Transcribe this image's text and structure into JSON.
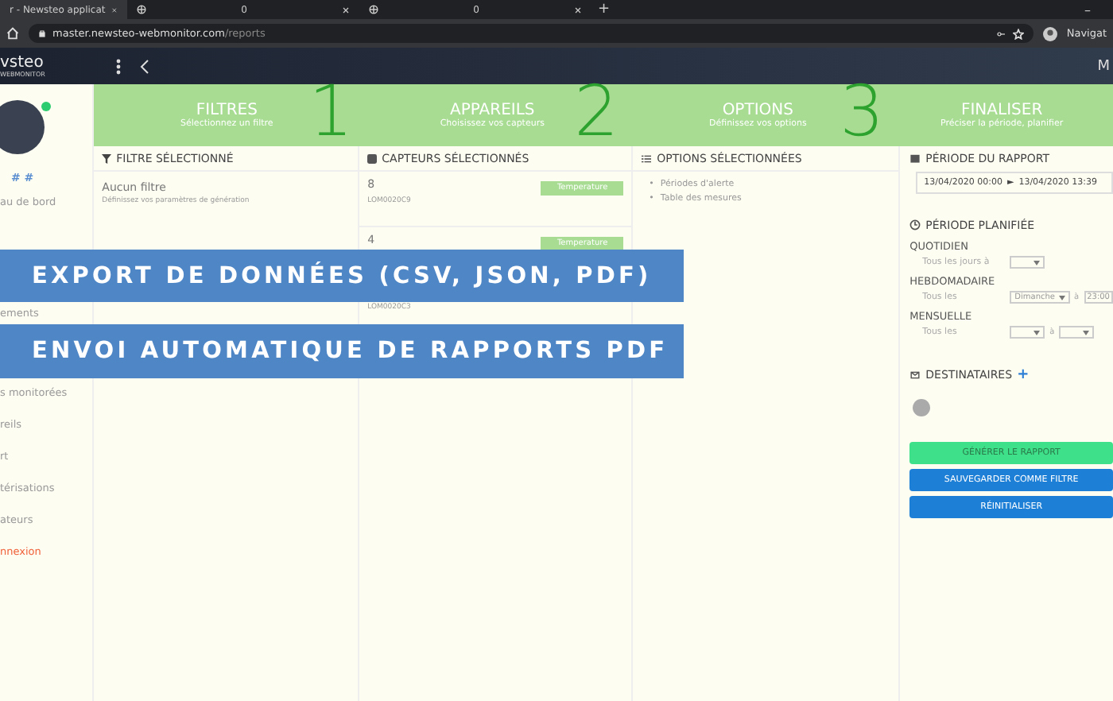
{
  "browser": {
    "tabs": [
      {
        "title": "r - Newsteo applicat",
        "selected": true
      },
      {
        "title": "0",
        "selected": false
      },
      {
        "title": "0",
        "selected": false
      }
    ],
    "new_tab": "+",
    "window_control": "–",
    "address": {
      "host": "master.newsteo-webmonitor.com",
      "path": "/reports"
    },
    "profile": "Navigat"
  },
  "app_header": {
    "logo": "vsteo",
    "logo_sub": "WEBMONITOR",
    "user": "M"
  },
  "sidebar": {
    "user_name": "# #",
    "online": true,
    "items": [
      {
        "label": "au de bord",
        "kind": "normal"
      },
      {
        "label": "ements",
        "kind": "normal"
      },
      {
        "label": "s monitorées",
        "kind": "normal"
      },
      {
        "label": "reils",
        "kind": "normal"
      },
      {
        "label": "rt",
        "kind": "normal"
      },
      {
        "label": "térisations",
        "kind": "normal"
      },
      {
        "label": "ateurs",
        "kind": "normal"
      },
      {
        "label": "nnexion",
        "kind": "logout"
      }
    ]
  },
  "steps": [
    {
      "title": "FILTRES",
      "subtitle": "Sélectionnez un filtre",
      "number": "1"
    },
    {
      "title": "APPAREILS",
      "subtitle": "Choisissez vos capteurs",
      "number": "2"
    },
    {
      "title": "OPTIONS",
      "subtitle": "Définissez vos options",
      "number": "3"
    },
    {
      "title": "FINALISER",
      "subtitle": "Préciser la période, planifier"
    }
  ],
  "filter_panel": {
    "title": "FILTRE SÉLECTIONNÉ",
    "name": "Aucun filtre",
    "hint": "Définissez vos paramètres de génération"
  },
  "sensors_panel": {
    "title": "CAPTEURS SÉLECTIONNÉS",
    "sensors": [
      {
        "name": "8",
        "id": "LOM0020C9",
        "tag": "Temperature"
      },
      {
        "name": "4",
        "id": "LOM0020C3",
        "tag": "Temperature"
      }
    ]
  },
  "options_panel": {
    "title": "OPTIONS SÉLECTIONNÉES",
    "bullet": "•",
    "items": [
      "Périodes d'alerte",
      "Table des mesures"
    ]
  },
  "report_period": {
    "title": "PÉRIODE DU RAPPORT",
    "start": "13/04/2020 00:00",
    "arrow": "►",
    "end": "13/04/2020 13:39"
  },
  "schedule": {
    "title": "PÉRIODE PLANIFIÉE",
    "groups": [
      {
        "heading": "QUOTIDIEN",
        "label": "Tous les jours à",
        "kind": "daily"
      },
      {
        "heading": "HEBDOMADAIRE",
        "label": "Tous les",
        "kind": "weekly",
        "select": "Dimanche",
        "at": "à",
        "time": "23:00"
      },
      {
        "heading": "MENSUELLE",
        "label": "Tous les",
        "kind": "monthly",
        "at": "à"
      }
    ]
  },
  "recipients": {
    "title": "DESTINATAIRES",
    "add": "+"
  },
  "buttons": [
    {
      "label": "GÉNÉRER LE RAPPORT",
      "kind": "success"
    },
    {
      "label": "SAUVEGARDER COMME FILTRE",
      "kind": "primary"
    },
    {
      "label": "RÉINITIALISER",
      "kind": "primary"
    }
  ],
  "banners": [
    "EXPORT DE DONNÉES (CSV, JSON, PDF)",
    "ENVOI AUTOMATIQUE DE RAPPORTS PDF"
  ]
}
